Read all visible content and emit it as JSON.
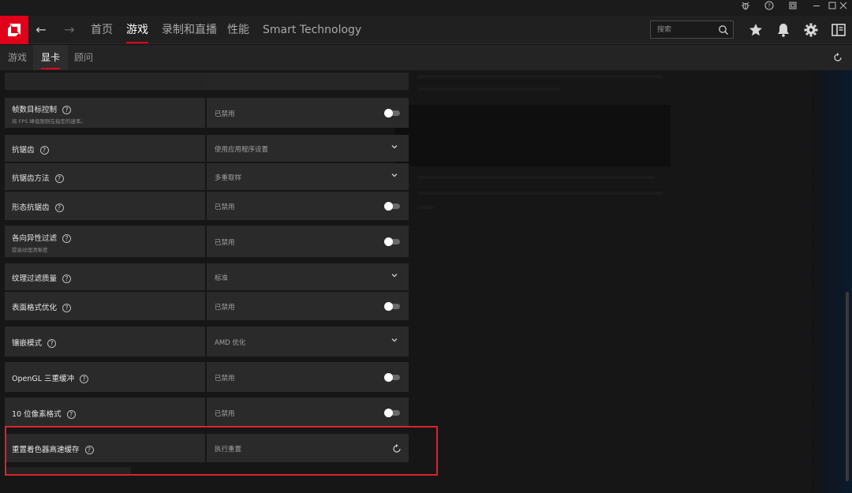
{
  "titlebar": {
    "controls": [
      "bug-icon",
      "help-icon",
      "restore-icon",
      "minimize-icon",
      "maximize-icon",
      "close-icon"
    ]
  },
  "nav": {
    "items": [
      {
        "label": "首页",
        "active": false
      },
      {
        "label": "游戏",
        "active": true
      },
      {
        "label": "录制和直播",
        "active": false
      },
      {
        "label": "性能",
        "active": false
      },
      {
        "label": "Smart Technology",
        "active": false
      }
    ],
    "search_placeholder": "搜索",
    "accent": "#e0001a"
  },
  "subtabs": [
    {
      "label": "游戏",
      "active": false
    },
    {
      "label": "显卡",
      "active": true
    },
    {
      "label": "顾问",
      "active": false
    }
  ],
  "settings": [
    {
      "label": "帧数目标控制",
      "sub": "将 FPS 峰值限制在指定的速率。",
      "value": "已禁用",
      "control": "toggle"
    },
    {
      "label": "抗锯齿",
      "value": "使用应用程序设置",
      "control": "dropdown"
    },
    {
      "label": "抗锯齿方法",
      "value": "多重取样",
      "control": "dropdown"
    },
    {
      "label": "形态抗锯齿",
      "value": "已禁用",
      "control": "toggle"
    },
    {
      "label": "各向异性过滤",
      "sub": "提高纹理清晰度",
      "value": "已禁用",
      "control": "toggle"
    },
    {
      "label": "纹理过滤质量",
      "value": "标准",
      "control": "dropdown"
    },
    {
      "label": "表面格式优化",
      "value": "已禁用",
      "control": "toggle"
    },
    {
      "label": "镶嵌模式",
      "value": "AMD 优化",
      "control": "dropdown"
    },
    {
      "label": "OpenGL 三重缓冲",
      "value": "已禁用",
      "control": "toggle"
    },
    {
      "label": "10 位像素格式",
      "value": "已禁用",
      "control": "toggle"
    },
    {
      "label": "重置着色器高速缓存",
      "value": "执行重置",
      "control": "reset"
    }
  ],
  "help_glyph": "?",
  "highlight_color": "#d9242b"
}
